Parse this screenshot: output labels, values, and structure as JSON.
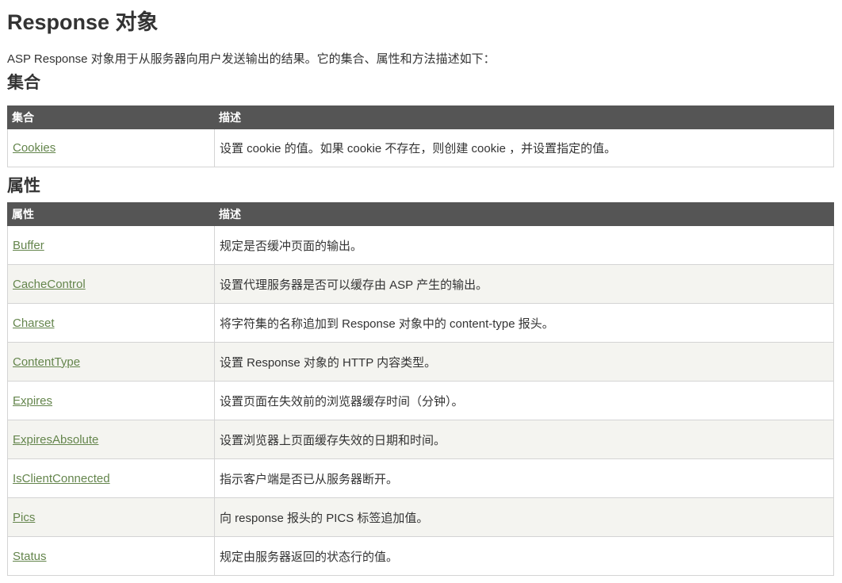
{
  "page_title": "Response 对象",
  "intro": "ASP Response 对象用于从服务器向用户发送输出的结果。它的集合、属性和方法描述如下：",
  "collections": {
    "heading": "集合",
    "header": [
      "集合",
      "描述"
    ],
    "rows": [
      {
        "name": "Cookies",
        "desc": "设置 cookie 的值。如果 cookie 不存在，则创建 cookie ，并设置指定的值。"
      }
    ]
  },
  "properties": {
    "heading": "属性",
    "header": [
      "属性",
      "描述"
    ],
    "rows": [
      {
        "name": "Buffer",
        "desc": "规定是否缓冲页面的输出。"
      },
      {
        "name": "CacheControl",
        "desc": "设置代理服务器是否可以缓存由 ASP 产生的输出。"
      },
      {
        "name": "Charset",
        "desc": "将字符集的名称追加到 Response 对象中的 content-type 报头。"
      },
      {
        "name": "ContentType",
        "desc": "设置 Response 对象的 HTTP 内容类型。"
      },
      {
        "name": "Expires",
        "desc": "设置页面在失效前的浏览器缓存时间（分钟）。"
      },
      {
        "name": "ExpiresAbsolute",
        "desc": "设置浏览器上页面缓存失效的日期和时间。"
      },
      {
        "name": "IsClientConnected",
        "desc": "指示客户端是否已从服务器断开。"
      },
      {
        "name": "Pics",
        "desc": "向 response 报头的 PICS 标签追加值。"
      },
      {
        "name": "Status",
        "desc": "规定由服务器返回的状态行的值。"
      }
    ]
  },
  "colors": {
    "header_bg": "#555555",
    "link": "#64854c",
    "alt_row": "#f4f4f0"
  }
}
